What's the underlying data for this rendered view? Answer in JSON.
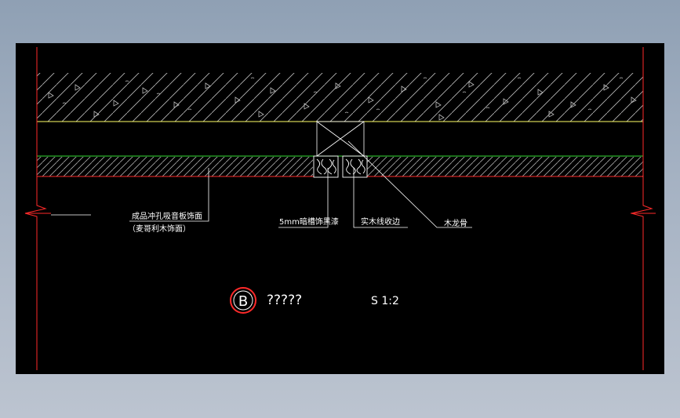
{
  "drawing": {
    "labels": {
      "panel": "成品冲孔吸音板饰面",
      "panel_sub": "（麦哥利木饰面）",
      "groove": "5mm暗槽饰黑漆",
      "trim": "实木线收边",
      "joist": "木龙骨"
    },
    "caption": {
      "marker": "B",
      "title": "?????",
      "scale": "S 1:2"
    },
    "colors": {
      "background": "#000000",
      "border_red": "#ff2a2a",
      "concrete_line": "#ffff66",
      "panel_line": "#33dd33",
      "annotation": "#ffffff",
      "hatch": "#cccccc"
    }
  }
}
